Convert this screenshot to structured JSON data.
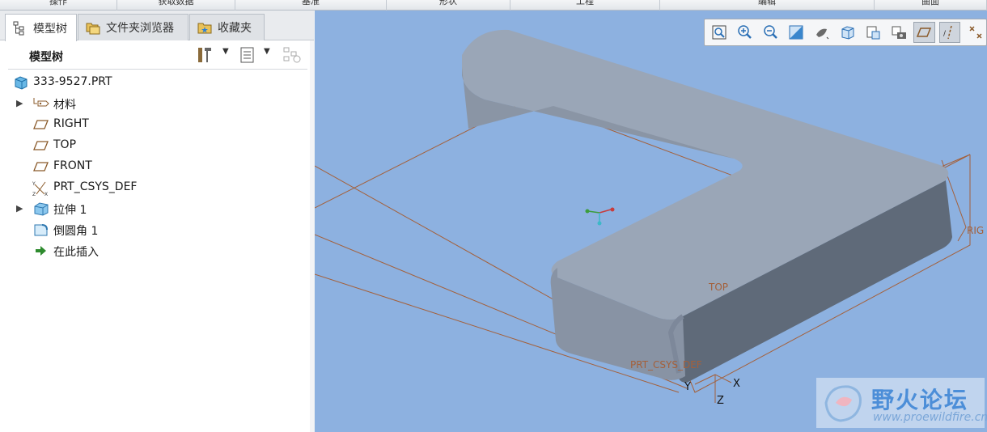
{
  "ribbon": {
    "groups": [
      "操作",
      "获取数据",
      "基准",
      "形状",
      "工程",
      "编辑",
      "曲面"
    ]
  },
  "tabs": [
    {
      "label": "模型树",
      "icon": "model-tree-icon",
      "active": true
    },
    {
      "label": "文件夹浏览器",
      "icon": "folder-browser-icon",
      "active": false
    },
    {
      "label": "收藏夹",
      "icon": "favorites-icon",
      "active": false
    }
  ],
  "tree_header": {
    "title": "模型树"
  },
  "tree": {
    "root": {
      "label": "333-9527.PRT",
      "icon": "part-icon"
    },
    "items": [
      {
        "label": "材料",
        "icon": "material-icon",
        "expandable": true
      },
      {
        "label": "RIGHT",
        "icon": "datum-plane-icon",
        "expandable": false
      },
      {
        "label": "TOP",
        "icon": "datum-plane-icon",
        "expandable": false
      },
      {
        "label": "FRONT",
        "icon": "datum-plane-icon",
        "expandable": false
      },
      {
        "label": "PRT_CSYS_DEF",
        "icon": "coordinate-system-icon",
        "expandable": false
      },
      {
        "label": "拉伸 1",
        "icon": "extrude-icon",
        "expandable": true
      },
      {
        "label": "倒圆角 1",
        "icon": "round-icon",
        "expandable": false
      },
      {
        "label": "在此插入",
        "icon": "insert-here-arrow-icon",
        "expandable": false
      }
    ]
  },
  "viewport": {
    "background": "#8db1e0",
    "labels": {
      "top_plane": "TOP",
      "right_plane": "RIG",
      "csys": "PRT_CSYS_DEF",
      "axis_x": "X",
      "axis_y": "Y",
      "axis_z": "Z"
    },
    "toolbar": [
      {
        "icon": "refit-icon",
        "on": false
      },
      {
        "icon": "zoom-in-icon",
        "on": false
      },
      {
        "icon": "zoom-out-icon",
        "on": false
      },
      {
        "icon": "repaint-icon",
        "on": false
      },
      {
        "icon": "display-style-icon",
        "on": false
      },
      {
        "icon": "saved-orientations-icon",
        "on": false
      },
      {
        "icon": "view-manager-icon",
        "on": false
      },
      {
        "icon": "perspective-view-icon",
        "on": false
      },
      {
        "icon": "plane-display-icon",
        "on": true
      },
      {
        "icon": "axis-display-icon",
        "on": true
      },
      {
        "icon": "point-display-icon",
        "on": false
      }
    ]
  },
  "watermark": {
    "title": "野火论坛",
    "url": "www.proewildfire.cn"
  }
}
